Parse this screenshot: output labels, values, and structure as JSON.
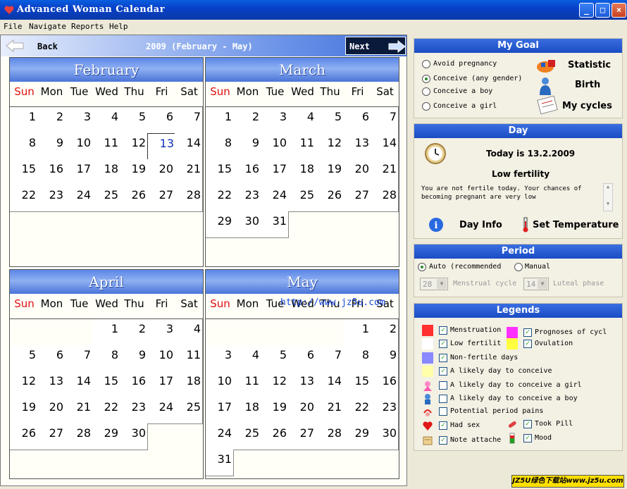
{
  "window": {
    "title": "Advanced Woman Calendar"
  },
  "menu": [
    "File",
    "Navigate",
    "Reports",
    "Help"
  ],
  "nav": {
    "back": "Back",
    "range": "2009 (February - May)",
    "next": "Next"
  },
  "day_names": [
    "Sun",
    "Mon",
    "Tue",
    "Wed",
    "Thu",
    "Fri",
    "Sat"
  ],
  "months": [
    {
      "name": "February",
      "start": 0,
      "days": 28,
      "today": 13
    },
    {
      "name": "March",
      "start": 0,
      "days": 31
    },
    {
      "name": "April",
      "start": 3,
      "days": 30
    },
    {
      "name": "May",
      "start": 5,
      "days": 31
    }
  ],
  "watermark": "http://www.jz5u.com",
  "goal": {
    "title": "My Goal",
    "options": [
      {
        "label": "Avoid pregnancy",
        "selected": false
      },
      {
        "label": "Conceive (any gender)",
        "selected": true
      },
      {
        "label": "Conceive a boy",
        "selected": false
      },
      {
        "label": "Conceive a girl",
        "selected": false
      }
    ],
    "actions": {
      "statistic": "Statistic",
      "birth": "Birth",
      "cycles": "My cycles"
    }
  },
  "day": {
    "title": "Day",
    "today": "Today is 13.2.2009",
    "fertility": "Low fertility",
    "message": "You are not fertile today. Your chances of becoming pregnant are very low",
    "info": "Day Info",
    "temperature": "Set Temperature"
  },
  "period": {
    "title": "Period",
    "auto": "Auto (recommended",
    "manual": "Manual",
    "cycle_value": "28",
    "cycle_label": "Menstrual cycle",
    "luteal_value": "14",
    "luteal_label": "Luteal phase"
  },
  "legends": {
    "title": "Legends",
    "items": [
      {
        "label": "Menstruation",
        "color": "#ff3030",
        "checked": true
      },
      {
        "label": "Prognoses of cycl",
        "color": "#ff30ff",
        "checked": true
      },
      {
        "label": "Low fertilit",
        "color": "#ffffff",
        "checked": true
      },
      {
        "label": "Ovulation",
        "color": "#ffff40",
        "checked": true
      },
      {
        "label": "Non-fertile days",
        "color": "#8888ff",
        "checked": true
      },
      {
        "label": "A likely day to conceive",
        "color": "#ffffaa",
        "checked": true
      },
      {
        "label": "A likely day to conceive a girl",
        "icon": "girl-icon",
        "checked": false
      },
      {
        "label": "A likely day to conceive a boy",
        "icon": "boy-icon",
        "checked": false
      },
      {
        "label": "Potential period pains",
        "icon": "pain-icon",
        "checked": false
      },
      {
        "label": "Had sex",
        "icon": "heart-icon",
        "checked": true
      },
      {
        "label": "Took Pill",
        "icon": "pill-icon",
        "checked": true
      },
      {
        "label": "Note attache",
        "icon": "note-icon",
        "checked": true
      },
      {
        "label": "Mood",
        "icon": "mood-icon",
        "checked": true
      }
    ]
  },
  "status": "JZ5U绿色下载站www.jz5u.com"
}
